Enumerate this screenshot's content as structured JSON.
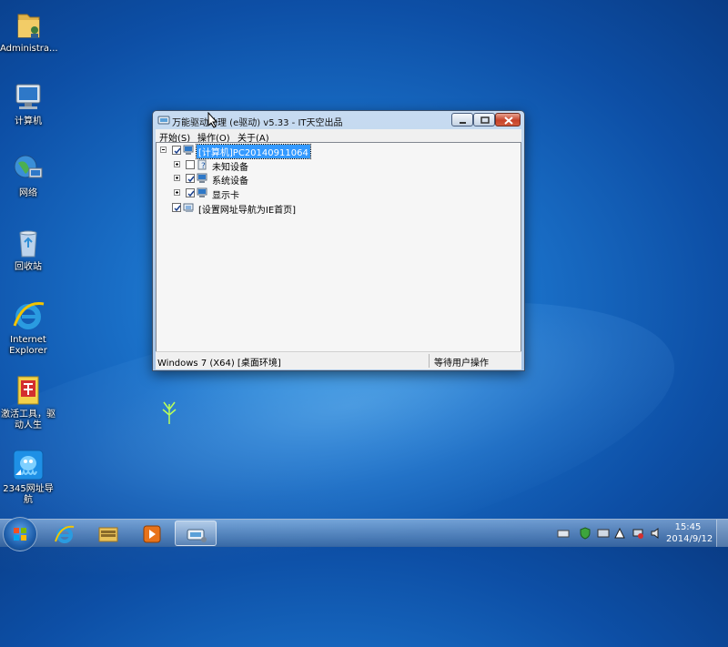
{
  "desktop": {
    "icons": [
      {
        "label": "Administra..."
      },
      {
        "label": "计算机"
      },
      {
        "label": "网络"
      },
      {
        "label": "回收站"
      },
      {
        "label": "Internet Explorer"
      },
      {
        "label": "激活工具，驱动人生"
      },
      {
        "label": "2345网址导航"
      }
    ]
  },
  "window": {
    "title": "万能驱动助理 (e驱动) v5.33 - IT天空出品",
    "menu": [
      "开始(S)",
      "操作(O)",
      "关于(A)"
    ],
    "tree": [
      {
        "label": "[计算机]PC20140911064",
        "checked": true,
        "selected": true
      },
      {
        "label": "未知设备",
        "checked": false
      },
      {
        "label": "系统设备",
        "checked": true
      },
      {
        "label": "显示卡",
        "checked": true
      },
      {
        "label": "[设置网址导航为IE首页]",
        "checked": true
      }
    ],
    "status_left": "Windows 7 (X64) [桌面环境]",
    "status_right": "等待用户操作"
  },
  "taskbar": {
    "clock_time": "15:45",
    "clock_date": "2014/9/12"
  }
}
